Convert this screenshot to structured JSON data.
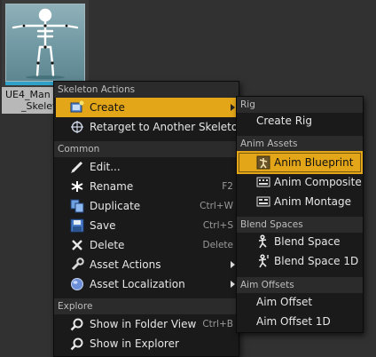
{
  "asset": {
    "name_line1": "UE4_Man",
    "name_line2": "_Skelet"
  },
  "main_menu": {
    "sections": [
      {
        "title": "Skeleton Actions",
        "items": [
          {
            "label": "Create",
            "shortcut": "",
            "icon": "create-icon",
            "submenu": true
          },
          {
            "label": "Retarget to Another Skeleton",
            "shortcut": "",
            "icon": "retarget-icon",
            "submenu": false
          }
        ]
      },
      {
        "title": "Common",
        "items": [
          {
            "label": "Edit...",
            "shortcut": "",
            "icon": "edit-icon"
          },
          {
            "label": "Rename",
            "shortcut": "F2",
            "icon": "rename-icon"
          },
          {
            "label": "Duplicate",
            "shortcut": "Ctrl+W",
            "icon": "duplicate-icon"
          },
          {
            "label": "Save",
            "shortcut": "Ctrl+S",
            "icon": "save-icon"
          },
          {
            "label": "Delete",
            "shortcut": "Delete",
            "icon": "delete-icon"
          },
          {
            "label": "Asset Actions",
            "shortcut": "",
            "icon": "asset-actions-icon",
            "submenu": true
          },
          {
            "label": "Asset Localization",
            "shortcut": "",
            "icon": "asset-localization-icon",
            "submenu": true
          }
        ]
      },
      {
        "title": "Explore",
        "items": [
          {
            "label": "Show in Folder View",
            "shortcut": "Ctrl+B",
            "icon": "folder-view-icon"
          },
          {
            "label": "Show in Explorer",
            "shortcut": "",
            "icon": "explorer-icon"
          }
        ]
      }
    ]
  },
  "sub_menu": {
    "sections": [
      {
        "title": "Rig",
        "items": [
          {
            "label": "Create Rig"
          }
        ]
      },
      {
        "title": "Anim Assets",
        "items": [
          {
            "label": "Anim Blueprint",
            "icon": "anim-blueprint-icon"
          },
          {
            "label": "Anim Composite",
            "icon": "anim-composite-icon"
          },
          {
            "label": "Anim Montage",
            "icon": "anim-montage-icon"
          }
        ]
      },
      {
        "title": "Blend Spaces",
        "items": [
          {
            "label": "Blend Space",
            "icon": "blend-space-icon"
          },
          {
            "label": "Blend Space 1D",
            "icon": "blend-space-1d-icon"
          }
        ]
      },
      {
        "title": "Aim Offsets",
        "items": [
          {
            "label": "Aim Offset"
          },
          {
            "label": "Aim Offset 1D"
          }
        ]
      }
    ]
  },
  "colors": {
    "highlight": "#e3a619",
    "menu_bg": "#1a1a1a",
    "header_bg": "#2b2b2b",
    "background": "#313131"
  }
}
